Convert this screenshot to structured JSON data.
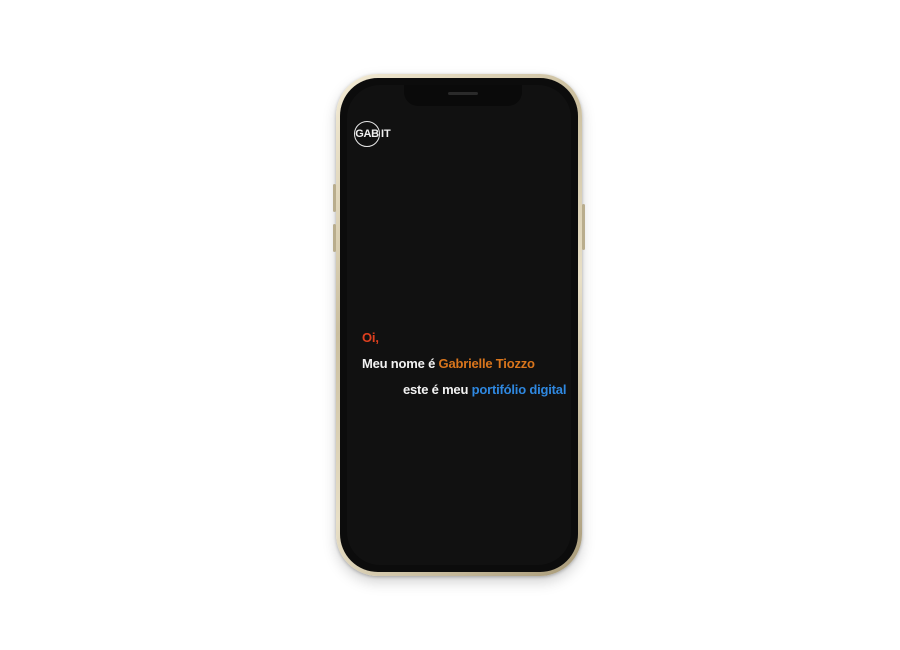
{
  "logo": {
    "circle_text": "GAB",
    "suffix_text": "IT"
  },
  "hero": {
    "greeting": "Oi,",
    "intro_prefix": "Meu nome é ",
    "name": "Gabrielle Tiozzo",
    "tagline_prefix": "este é meu ",
    "tagline_highlight": "portifólio digital"
  },
  "colors": {
    "greeting": "#e0401f",
    "name": "#d9751c",
    "highlight": "#2f88e0",
    "screen_bg": "#111111",
    "frame": "#cbbf9f"
  }
}
